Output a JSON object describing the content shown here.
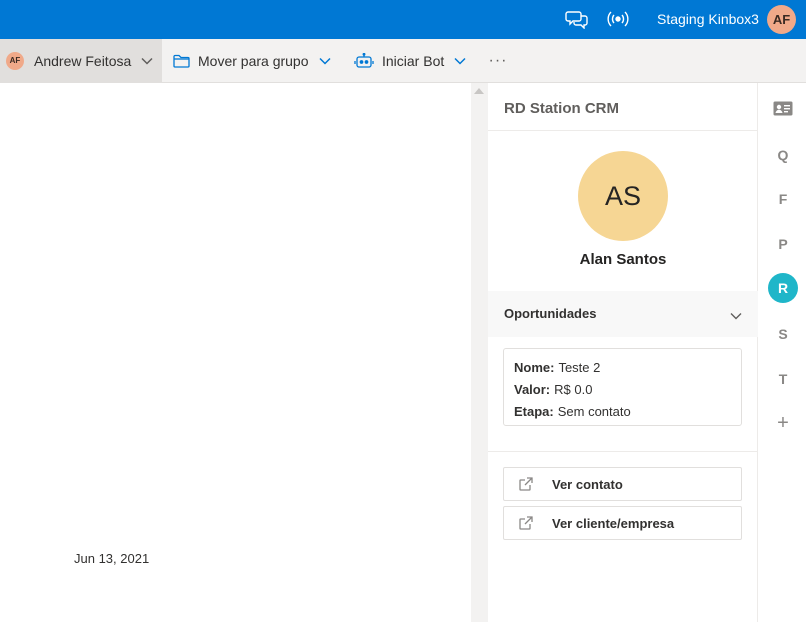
{
  "topbar": {
    "org_name": "Staging Kinbox3",
    "avatar_initials": "AF",
    "chat_icon": "chat-bubbles-icon",
    "broadcast_icon": "broadcast-icon"
  },
  "commands": {
    "assignee_initials": "AF",
    "assignee_name": "Andrew Feitosa",
    "move_group_label": "Mover para grupo",
    "start_bot_label": "Iniciar Bot",
    "more_label": "···"
  },
  "conversation": {
    "date": "Jun 13, 2021"
  },
  "crm_panel": {
    "title": "RD Station CRM",
    "contact_initials": "AS",
    "contact_name": "Alan Santos",
    "opportunities_label": "Oportunidades",
    "opportunity": {
      "name_key": "Nome:",
      "name_value": "Teste 2",
      "value_key": "Valor:",
      "value_value": "R$ 0.0",
      "stage_key": "Etapa:",
      "stage_value": "Sem contato"
    },
    "view_contact_label": "Ver contato",
    "view_company_label": "Ver cliente/empresa"
  },
  "rail": {
    "items": [
      {
        "label": "",
        "icon": "contact-card-icon"
      },
      {
        "label": "Q"
      },
      {
        "label": "F"
      },
      {
        "label": "P"
      },
      {
        "label": "R",
        "active": true
      },
      {
        "label": "S"
      },
      {
        "label": "T"
      },
      {
        "label": "+"
      }
    ]
  },
  "colors": {
    "header_blue": "#0078d4",
    "avatar_orange": "#f0a989",
    "contact_avatar": "#f6d694",
    "rail_active": "#1fb6c9"
  }
}
